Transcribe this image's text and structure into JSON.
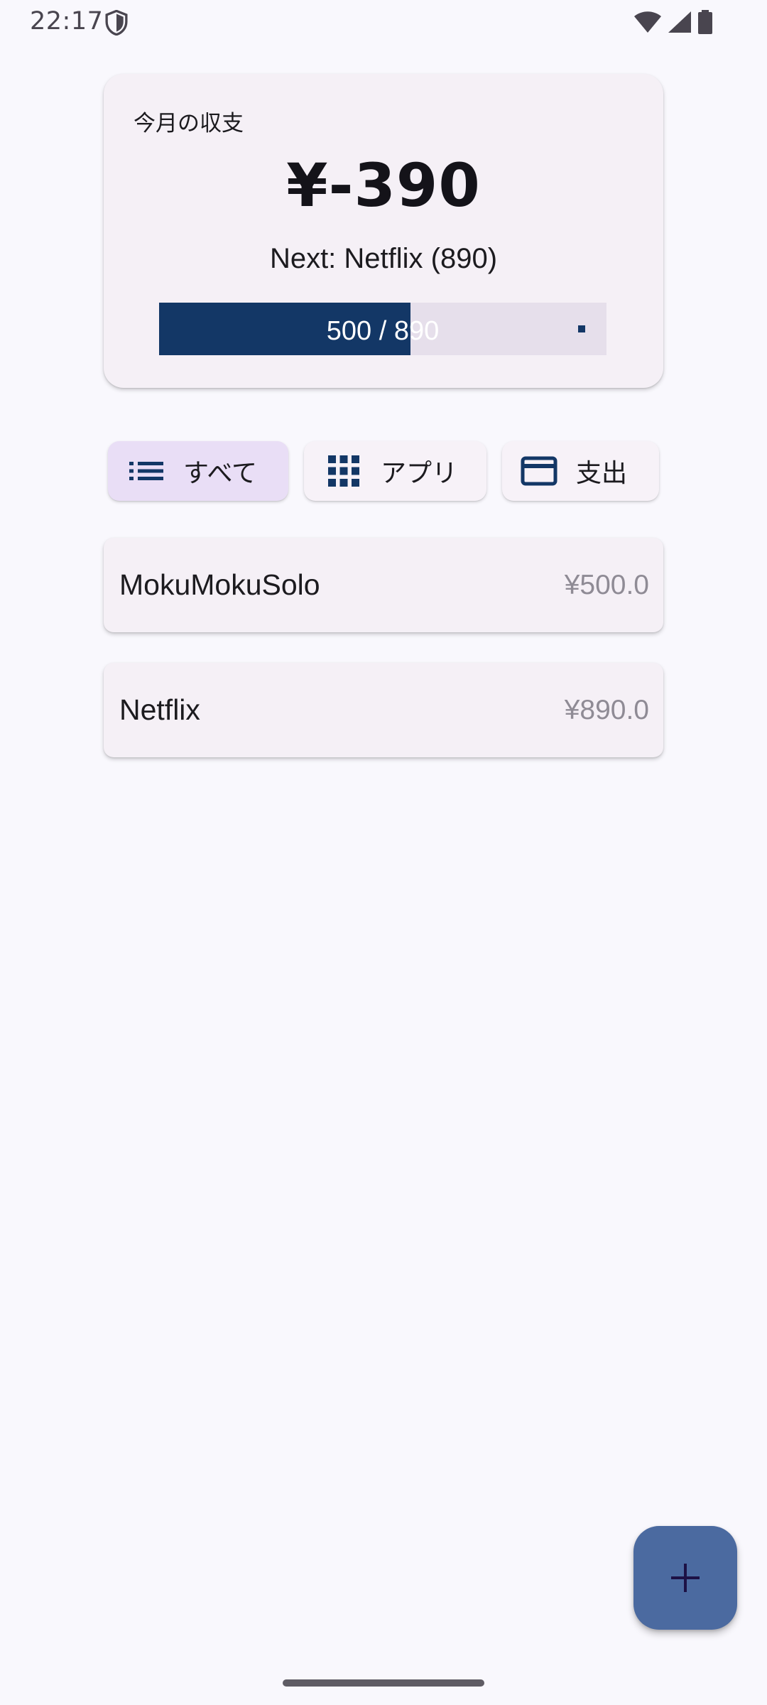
{
  "status_bar": {
    "time": "22:17"
  },
  "summary": {
    "title": "今月の収支",
    "amount": "¥-390",
    "next_label": "Next: Netflix (890)",
    "progress": {
      "current": 500,
      "total": 890,
      "label": "500 / 890",
      "fill_fraction": 0.5618
    }
  },
  "filters": [
    {
      "label": "すべて",
      "icon": "list-icon",
      "selected": true
    },
    {
      "label": "アプリ",
      "icon": "grid-icon",
      "selected": false
    },
    {
      "label": "支出",
      "icon": "credit-card-icon",
      "selected": false
    }
  ],
  "items": [
    {
      "name": "MokuMokuSolo",
      "amount": "¥500.0"
    },
    {
      "name": "Netflix",
      "amount": "¥890.0"
    }
  ],
  "fab": {
    "icon": "plus-icon"
  },
  "colors": {
    "background": "#f9f8fd",
    "card": "#f5f0f6",
    "progress_fill": "#133766",
    "progress_track": "#e6dfeb",
    "chip_selected": "#e9def6",
    "fab": "#4b6aa0",
    "icon_primary": "#133766"
  }
}
